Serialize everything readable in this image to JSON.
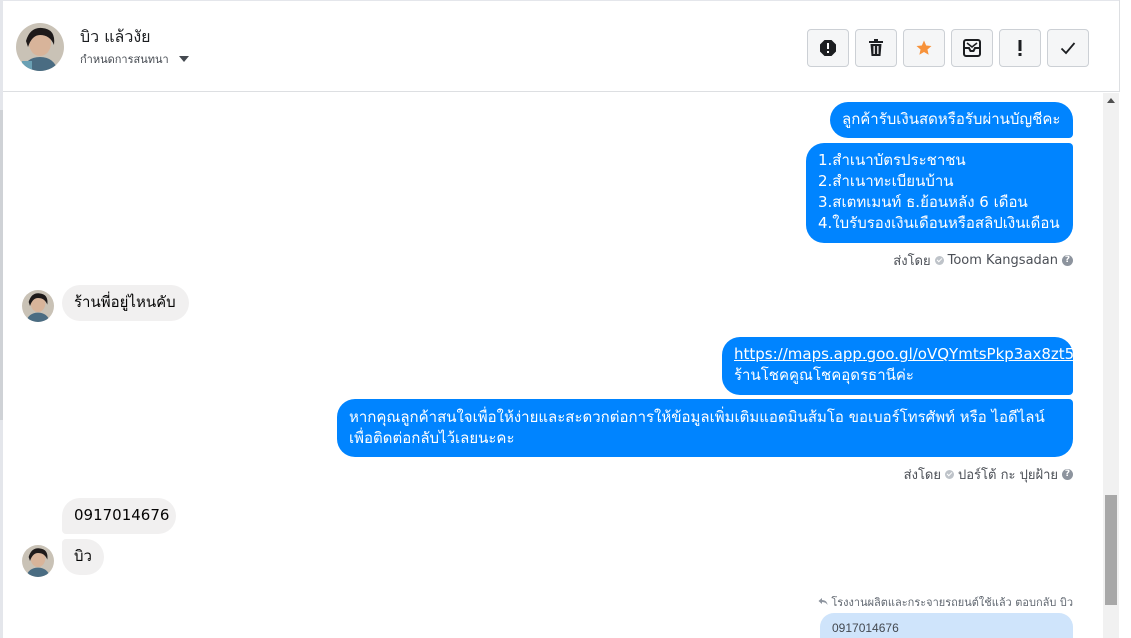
{
  "header": {
    "contact_name": "บิว แล้วงัย",
    "subtitle": "กำหนดการสนทนา"
  },
  "toolbar": {
    "buttons": [
      "report-spam-icon",
      "trash-icon",
      "star-icon",
      "mark-unread-icon",
      "exclamation-icon",
      "check-icon"
    ],
    "star_color": "#f7923a"
  },
  "messages": {
    "m1": "ลูกค้ารับเงินสดหรือรับผ่านบัญชีคะ",
    "m2_lines": [
      "1.สำเนาบัตรประชาชน",
      "2.สำเนาทะเบียนบ้าน",
      "3.สเตทเมนท์ ธ.ย้อนหลัง 6 เดือน",
      "4.ใบรับรองเงินเดือนหรือสลิปเงินเดือน"
    ],
    "sent_by_1_label": "ส่งโดย",
    "sent_by_1_name": "Toom Kangsadan",
    "in1": "ร้านพี่อยู่ไหนคับ",
    "m3_link": "https://maps.app.goo.gl/oVQYmtsPkp3ax8zt5",
    "m3_text": "ร้านโชคคูณโชคอุดรธานีค่ะ",
    "m4_line1": "หากคุณลูกค้าสนใจเพื่อให้ง่ายและสะดวกต่อการให้ข้อมูลเพิ่มเติมแอดมินส้มโอ ขอเบอร์โทรศัพท์ หรือ ไอดีไลน์",
    "m4_line2": "เพื่อติดต่อกลับไว้เลยนะคะ",
    "sent_by_2_label": "ส่งโดย",
    "sent_by_2_name": "ปอร์โต้ กะ ปุยฝ้าย",
    "in2": "0917014676",
    "in3": "บิว",
    "reply_note": "โรงงานผลิตและกระจายรถยนต์ใช้แล้ว ตอบกลับ บิว",
    "quoted": "0917014676"
  },
  "colors": {
    "outgoing": "#0084ff",
    "incoming": "#f1f0f0"
  }
}
